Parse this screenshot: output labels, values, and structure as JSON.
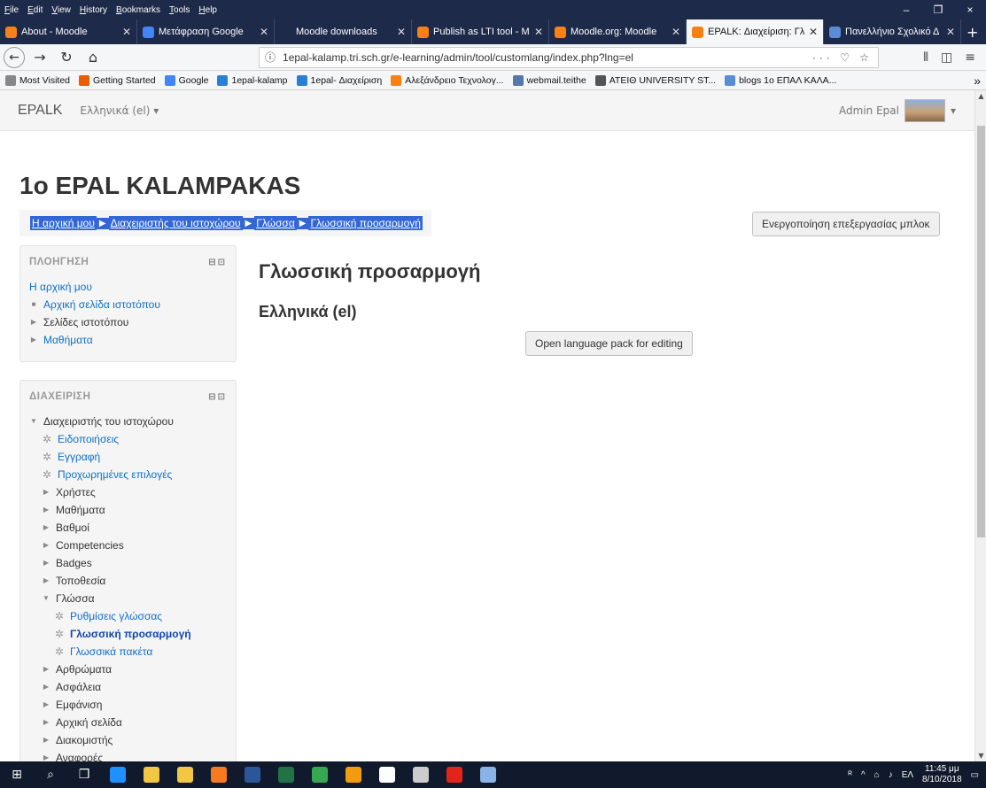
{
  "menubar": {
    "items": [
      "File",
      "Edit",
      "View",
      "History",
      "Bookmarks",
      "Tools",
      "Help"
    ],
    "minimize": "–",
    "restore": "❐",
    "close": "×"
  },
  "tabs": [
    {
      "label": "About - Moodle",
      "color": "#f98012"
    },
    {
      "label": "Μετάφραση Google",
      "color": "#4285f4"
    },
    {
      "label": "Moodle downloads",
      "color": "#1e2a4a"
    },
    {
      "label": "Publish as LTI tool - M",
      "color": "#f98012"
    },
    {
      "label": "Moodle.org: Moodle",
      "color": "#f98012"
    },
    {
      "label": "EPALK: Διαχείριση: Γλ",
      "color": "#f98012"
    },
    {
      "label": "Πανελλήνιο Σχολικό Δ",
      "color": "#5b8dd6"
    }
  ],
  "nav": {
    "url": "1epal-kalamp.tri.sch.gr/e-learning/admin/tool/customlang/index.php?lng=el",
    "url_icons": "··· ♡ ☆"
  },
  "bookmarks": [
    {
      "label": "Most Visited",
      "color": "#888888"
    },
    {
      "label": "Getting Started",
      "color": "#e66000"
    },
    {
      "label": "Google",
      "color": "#4285f4"
    },
    {
      "label": "1epal-kalamp",
      "color": "#2a7fd4"
    },
    {
      "label": "1epal- Διαχείριση",
      "color": "#2a7fd4"
    },
    {
      "label": "Αλεξάνδρειο Τεχνολογ...",
      "color": "#f98012"
    },
    {
      "label": "webmail.teithe",
      "color": "#5577aa"
    },
    {
      "label": "ATEIΘ UNIVERSITY ST...",
      "color": "#555555"
    },
    {
      "label": "blogs 1ο ΕΠΑΛ ΚΑΛΑ...",
      "color": "#5b8dd6"
    }
  ],
  "moodle": {
    "brand": "EPALK",
    "language": "Ελληνικά (el) ▾",
    "user": "Admin Epal",
    "site_title": "1o EPAL KALAMPAKAS",
    "breadcrumb": [
      "Η αρχική μου",
      "Διαχειριστής του ιστοχώρου",
      "Γλώσσα",
      "Γλωσσική προσαρμογή"
    ],
    "edit_blocks": "Ενεργοποίηση επεξεργασίας μπλοκ",
    "heading": "Γλωσσική προσαρμογή",
    "subheading": "Ελληνικά (el)",
    "open_pack": "Open language pack for editing"
  },
  "navigation_block": {
    "title": "ΠΛΟΗΓΗΣΗ",
    "home": "Η αρχική μου",
    "items": [
      "Αρχική σελίδα ιστοτόπου",
      "Σελίδες ιστοτόπου",
      "Μαθήματα"
    ]
  },
  "admin_block": {
    "title": "ΔΙΑΧΕΙΡΙΣΗ",
    "root": "Διαχειριστής του ιστοχώρου",
    "gear_items": [
      "Ειδοποιήσεις",
      "Εγγραφή",
      "Προχωρημένες επιλογές"
    ],
    "collapsed_a": [
      "Χρήστες",
      "Μαθήματα",
      "Βαθμοί",
      "Competencies",
      "Badges",
      "Τοποθεσία"
    ],
    "language": "Γλώσσα",
    "language_items": [
      "Ρυθμίσεις γλώσσας",
      "Γλωσσική προσαρμογή",
      "Γλωσσικά πακέτα"
    ],
    "collapsed_b": [
      "Αρθρώματα",
      "Ασφάλεια",
      "Εμφάνιση",
      "Αρχική σελίδα",
      "Διακομιστής",
      "Αναφορές"
    ]
  },
  "taskbar": {
    "apps": [
      {
        "name": "edge",
        "color": "#1e90ff"
      },
      {
        "name": "explorer",
        "color": "#f2c744"
      },
      {
        "name": "store",
        "color": "#f2c744"
      },
      {
        "name": "firefox",
        "color": "#f77b1e"
      },
      {
        "name": "word",
        "color": "#2b579a"
      },
      {
        "name": "excel",
        "color": "#217346"
      },
      {
        "name": "chrome",
        "color": "#34a853"
      },
      {
        "name": "outlook",
        "color": "#f29b0f"
      },
      {
        "name": "document",
        "color": "#ffffff"
      },
      {
        "name": "app",
        "color": "#cccccc"
      },
      {
        "name": "acrobat",
        "color": "#e1251b"
      },
      {
        "name": "paint",
        "color": "#8ab4e8"
      }
    ],
    "lang": "ΕΛ",
    "time": "11:45 μμ",
    "date": "8/10/2018"
  }
}
